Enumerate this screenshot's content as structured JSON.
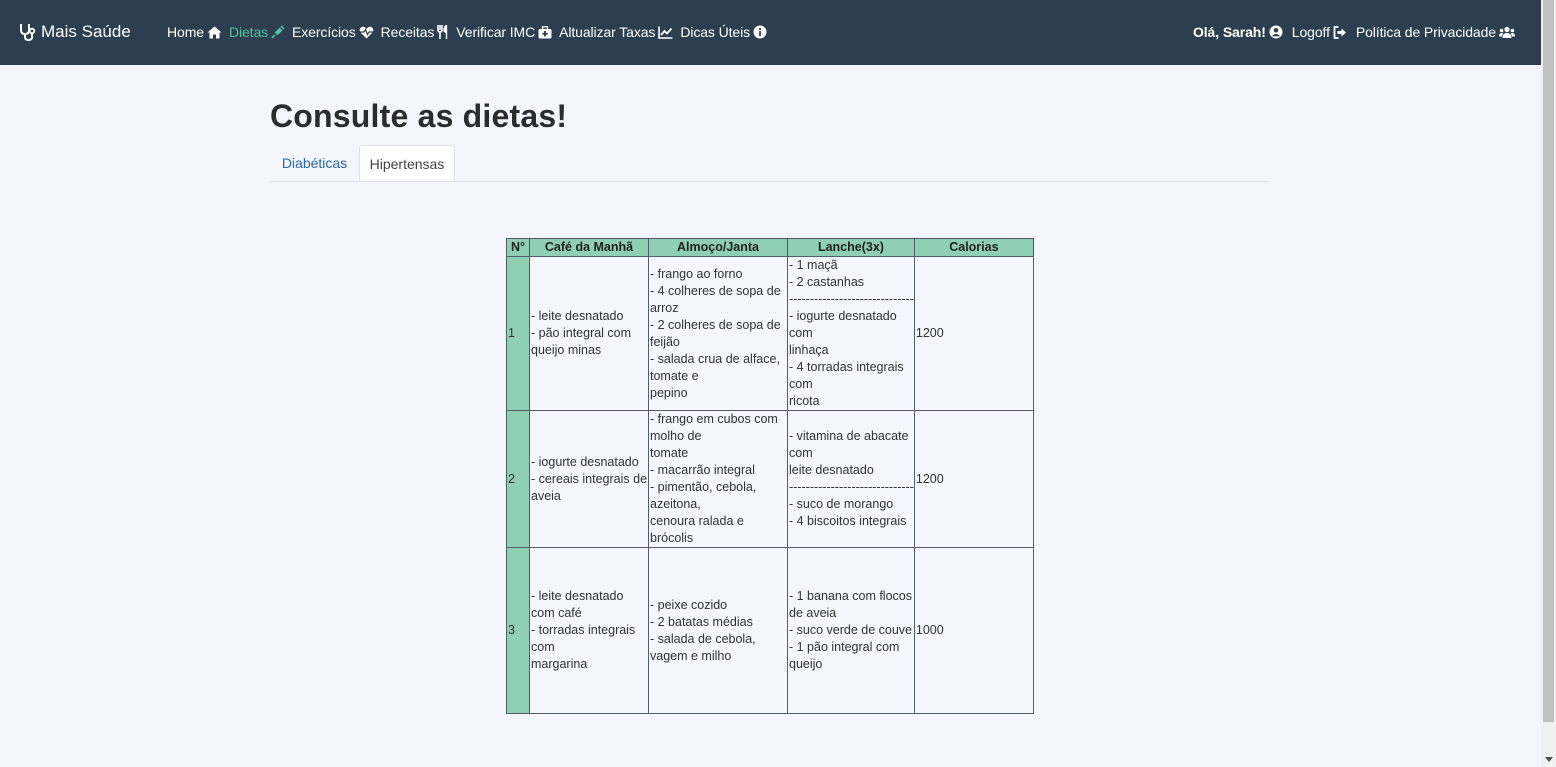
{
  "navbar": {
    "brand": "Mais Saúde",
    "left_items": [
      {
        "label": "Home",
        "icon": "home-icon",
        "active": false
      },
      {
        "label": "Dietas",
        "icon": "syringe-icon",
        "active": true
      },
      {
        "label": "Exercícios",
        "icon": "heartbeat-icon",
        "active": false
      },
      {
        "label": "Receitas",
        "icon": "utensils-icon",
        "active": false
      },
      {
        "label": "Verificar IMC",
        "icon": "medkit-icon",
        "active": false
      },
      {
        "label": "Altualizar Taxas",
        "icon": "chart-line-icon",
        "active": false
      },
      {
        "label": "Dicas Úteis",
        "icon": "info-circle-icon",
        "active": false
      }
    ],
    "greeting": "Olá, Sarah!",
    "logoff": "Logoff",
    "privacy": "Política de Privacidade"
  },
  "colors": {
    "navbar_bg": "#2c3e50",
    "active_link": "#4fc3a1",
    "table_header_bg": "#8fcfb3",
    "page_bg": "#f4f5fd"
  },
  "page": {
    "title": "Consulte as dietas!",
    "tabs": [
      {
        "label": "Diabéticas",
        "active": false
      },
      {
        "label": "Hipertensas",
        "active": true
      }
    ]
  },
  "table": {
    "headers": [
      "N°",
      "Café da Manhã",
      "Almoço/Janta",
      "Lanche(3x)",
      "Calorias"
    ],
    "rows": [
      {
        "num": "1",
        "cafe": [
          "- leite desnatado",
          "- pão integral com",
          "queijo minas"
        ],
        "almoco": [
          "- frango ao forno",
          "- 4 colheres de sopa de",
          "arroz",
          "- 2 colheres de sopa de",
          "feijão",
          "- salada crua de alface,",
          "tomate e",
          "pepino"
        ],
        "lanche": [
          "- 1 maçã",
          "- 2 castanhas",
          "------------------------------",
          "- iogurte desnatado",
          "com",
          "linhaça",
          "- 4 torradas integrais",
          "com",
          "ricota"
        ],
        "calorias": "1200"
      },
      {
        "num": "2",
        "cafe": [
          "- iogurte desnatado",
          "- cereais integrais de",
          "aveia"
        ],
        "almoco": [
          "- frango em cubos com",
          "molho de",
          "tomate",
          "- macarrão integral",
          "- pimentão, cebola,",
          "azeitona,",
          "cenoura ralada e",
          "brócolis"
        ],
        "lanche": [
          "- vitamina de abacate",
          "com",
          "leite desnatado",
          "------------------------------",
          "- suco de morango",
          "- 4 biscoitos integrais"
        ],
        "calorias": "1200"
      },
      {
        "num": "3",
        "cafe": [
          "- leite desnatado",
          "com café",
          "- torradas integrais",
          "com",
          "margarina"
        ],
        "almoco": [
          "- peixe cozido",
          "- 2 batatas médias",
          "- salada de cebola,",
          "vagem e milho"
        ],
        "lanche": [
          "- 1 banana com flocos",
          "de aveia",
          "- suco verde de couve",
          "- 1 pão integral com",
          "queijo"
        ],
        "calorias": "1000"
      }
    ]
  }
}
